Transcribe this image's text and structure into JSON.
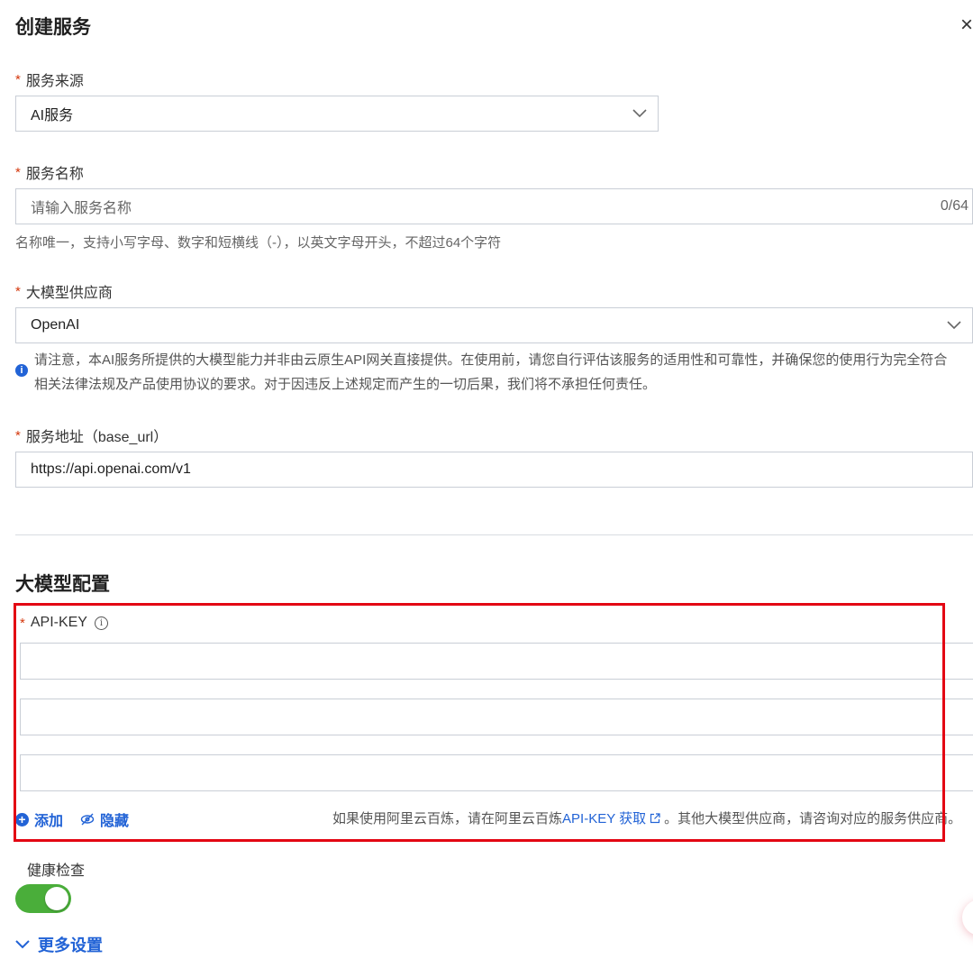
{
  "header": {
    "title": "创建服务",
    "close_label": "×"
  },
  "service_source": {
    "label": "服务来源",
    "required_mark": "*",
    "value": "AI服务"
  },
  "service_name": {
    "label": "服务名称",
    "required_mark": "*",
    "placeholder": "请输入服务名称",
    "counter": "0/64",
    "help": "名称唯一，支持小写字母、数字和短横线（-），以英文字母开头，不超过64个字符"
  },
  "provider": {
    "label": "大模型供应商",
    "required_mark": "*",
    "value": "OpenAI",
    "notice_line1": "请注意，本AI服务所提供的大模型能力并非由云原生API网关直接提供。在使用前，请您自行评估该服务的适用性和可靠性，并确保您的使用行为完全符合",
    "notice_line2": "相关法律法规及产品使用协议的要求。对于因违反上述规定而产生的一切后果，我们将不承担任何责任。"
  },
  "base_url": {
    "label": "服务地址（base_url）",
    "required_mark": "*",
    "value": "https://api.openai.com/v1"
  },
  "model_config": {
    "section_title": "大模型配置",
    "api_key_label": "API-KEY",
    "required_mark": "*",
    "add_label": "添加",
    "hide_label": "隐藏",
    "note_prefix": "如果使用阿里云百炼，请在阿里云百炼",
    "note_link": "API-KEY 获取",
    "note_suffix": "。其他大模型供应商，请咨询对应的服务供应商。"
  },
  "health_check": {
    "label": "健康检查",
    "enabled": true
  },
  "more_settings": {
    "label": "更多设置"
  },
  "colors": {
    "accent": "#2263d6",
    "required": "#d4380d",
    "toggle_on": "#4aae3a",
    "highlight": "#e30613"
  }
}
